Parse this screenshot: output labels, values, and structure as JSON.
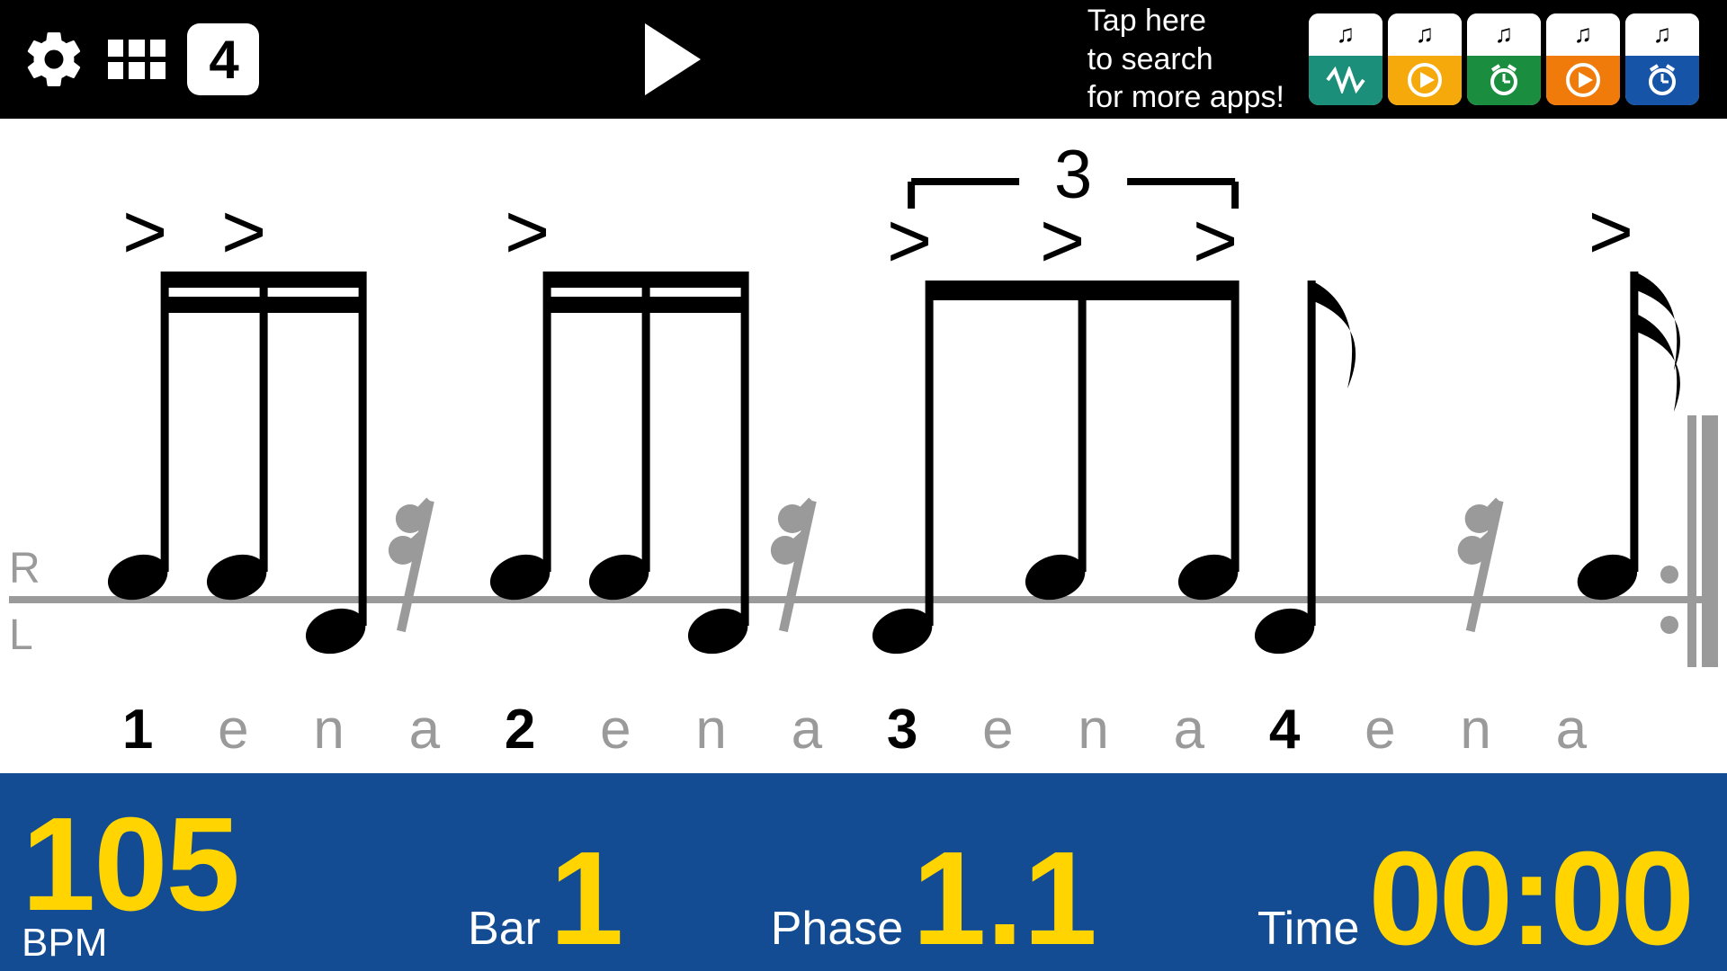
{
  "header": {
    "beat_count": "4",
    "search_text": "Tap here\nto search\nfor more apps!"
  },
  "apps": [
    {
      "color": "#1b8f7a",
      "icon": "wave"
    },
    {
      "color": "#f5a90a",
      "icon": "play"
    },
    {
      "color": "#1b8d3f",
      "icon": "clock"
    },
    {
      "color": "#f07a0a",
      "icon": "play"
    },
    {
      "color": "#1654a8",
      "icon": "clock"
    }
  ],
  "notation": {
    "staff_labels": {
      "top": "R",
      "bottom": "L"
    },
    "triplet_label": "3",
    "counts": [
      {
        "t": "1",
        "s": 1
      },
      {
        "t": "e",
        "s": 0
      },
      {
        "t": "n",
        "s": 0
      },
      {
        "t": "a",
        "s": 0
      },
      {
        "t": "2",
        "s": 1
      },
      {
        "t": "e",
        "s": 0
      },
      {
        "t": "n",
        "s": 0
      },
      {
        "t": "a",
        "s": 0
      },
      {
        "t": "3",
        "s": 1
      },
      {
        "t": "e",
        "s": 0
      },
      {
        "t": "n",
        "s": 0
      },
      {
        "t": "a",
        "s": 0
      },
      {
        "t": "4",
        "s": 1
      },
      {
        "t": "e",
        "s": 0
      },
      {
        "t": "n",
        "s": 0
      },
      {
        "t": "a",
        "s": 0
      }
    ]
  },
  "status": {
    "labels": {
      "bpm": "BPM",
      "bar": "Bar",
      "phase": "Phase",
      "time": "Time"
    },
    "values": {
      "bpm": "105",
      "bar": "1",
      "phase": "1.1",
      "time": "00:00"
    }
  },
  "colors": {
    "accent": "#ffd400",
    "bar": "#134c92"
  }
}
